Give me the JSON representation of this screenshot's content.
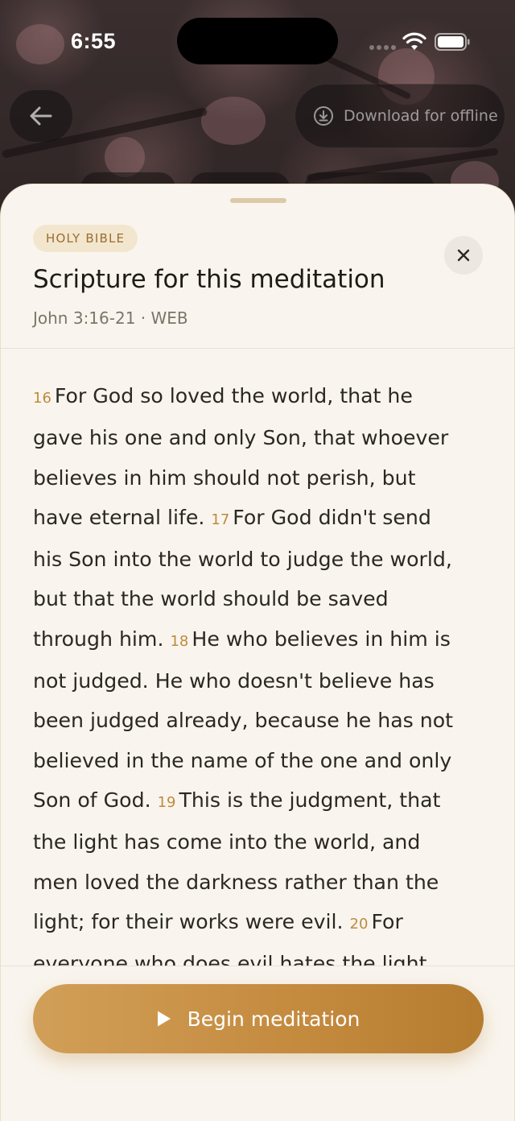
{
  "status_bar": {
    "time": "6:55"
  },
  "top_bar": {
    "back_icon": "arrow-left-icon",
    "download_label": "Download for offline",
    "download_icon": "download-circle-icon"
  },
  "sheet": {
    "badge": "HOLY BIBLE",
    "title": "Scripture for this meditation",
    "subtitle": "John 3:16-21 · WEB",
    "close_icon": "close-icon",
    "lines": [
      [
        {
          "num": "16"
        },
        {
          "text": "For God so loved the world, that he"
        }
      ],
      [
        {
          "text": "gave his one and only Son, that whoever"
        }
      ],
      [
        {
          "text": "believes in him should not perish, but"
        }
      ],
      [
        {
          "text": "have eternal life. "
        },
        {
          "num": "17"
        },
        {
          "text": "For God didn't send"
        }
      ],
      [
        {
          "text": "his Son into the world to judge the world,"
        }
      ],
      [
        {
          "text": "but that the world should be saved"
        }
      ],
      [
        {
          "text": "through him. "
        },
        {
          "num": "18"
        },
        {
          "text": "He who believes in him is"
        }
      ],
      [
        {
          "text": "not judged. He who doesn't believe has"
        }
      ],
      [
        {
          "text": "been judged already, because he has not"
        }
      ],
      [
        {
          "text": "believed in the name of the one and only"
        }
      ],
      [
        {
          "text": "Son of God. "
        },
        {
          "num": "19"
        },
        {
          "text": "This is the judgment, that"
        }
      ],
      [
        {
          "text": "the light has come into the world, and"
        }
      ],
      [
        {
          "text": "men loved the darkness rather than the"
        }
      ],
      [
        {
          "text": "light; for their works were evil. "
        },
        {
          "num": "20"
        },
        {
          "text": "For"
        }
      ],
      [
        {
          "text": "everyone who does evil hates the light,"
        }
      ]
    ]
  },
  "footer": {
    "begin_label": "Begin meditation",
    "begin_icon": "play-icon"
  },
  "colors": {
    "sheet_background": "#f9f5ee",
    "accent": "#c48a3e",
    "verse_number": "#bf8a3f",
    "badge_background": "#f3e6cf"
  }
}
